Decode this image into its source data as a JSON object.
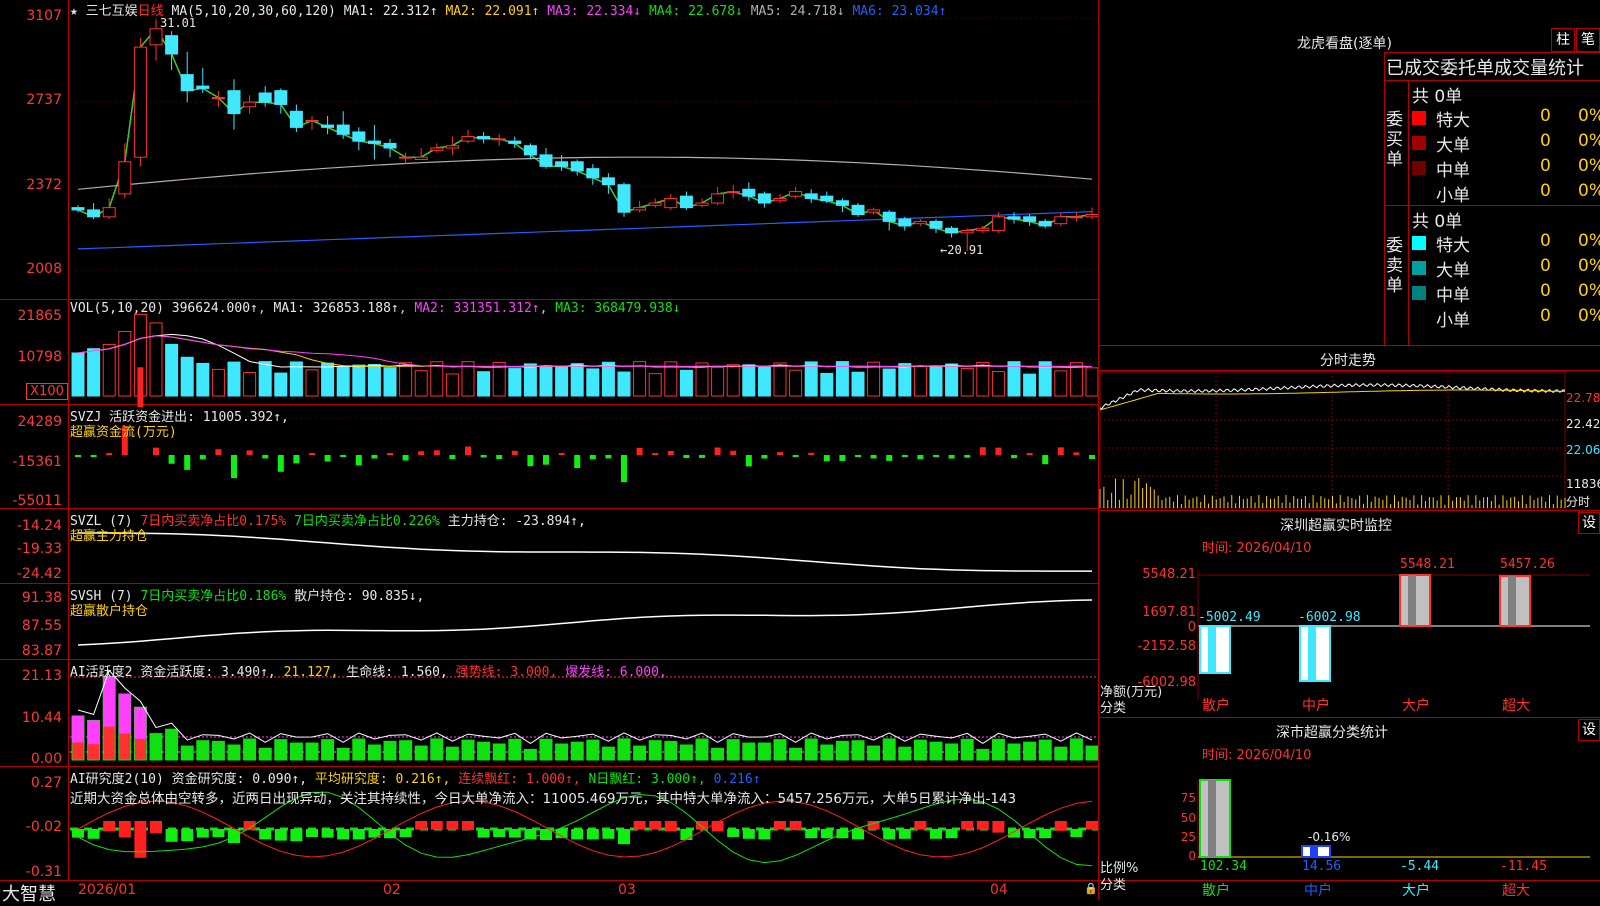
{
  "chart_title": {
    "stock": "三七互娱",
    "period": "日线",
    "ma_label": "MA(5,10,20,30,60,120)",
    "ma_values": [
      "MA1: 22.312↑",
      "MA2: 22.091↑",
      "MA3: 22.334↓",
      "MA4: 22.678↓",
      "MA5: 24.718↓",
      "MA6: 23.034↑"
    ],
    "peak_note": "31.01",
    "low_note": "←20.91"
  },
  "price_axis": [
    "3107",
    "2737",
    "2372",
    "2008"
  ],
  "vol": {
    "header": [
      "VOL(5,10,20)",
      "396624.000↑",
      "MA1: 326853.188↑",
      "MA2: 331351.312↑",
      "MA3: 368479.938↓"
    ],
    "axis": [
      "21865",
      "10798",
      "X100"
    ]
  },
  "svzj": {
    "header": "SVZJ  活跃资金进出: 11005.392↑,",
    "sub": "超赢资金流(万元)",
    "axis": [
      "24289",
      "-15361",
      "-55011"
    ]
  },
  "svzl": {
    "header_a": "SVZL (7)",
    "header_b": "7日内买卖净占比0.175%",
    "header_c": "7日内买卖净占比0.226%",
    "header_d": "主力持仓: -23.894↑,",
    "sub": "超赢主力持仓",
    "axis": [
      "-14.24",
      "-19.33",
      "-24.42"
    ]
  },
  "svsh": {
    "header_a": "SVSH (7)",
    "header_b": "7日内买卖净占比0.186%",
    "header_c": "散户持仓: 90.835↓,",
    "sub": "超赢散户持仓",
    "axis": [
      "91.38",
      "87.55",
      "83.87"
    ]
  },
  "ai_active": {
    "header_a": "AI活跃度2",
    "header_b": "资金活跃度: 3.490↑,",
    "header_c": "21.127,",
    "header_d": "生命线: 1.560,",
    "header_e": "强势线: 3.000,",
    "header_f": "爆发线: 6.000,",
    "axis": [
      "21.13",
      "10.44",
      "0.00"
    ]
  },
  "ai_research": {
    "header_a": "AI研究度2(10)",
    "header_b": "资金研究度: 0.090↑,",
    "header_c": "平均研究度: 0.216↑,",
    "header_d": "连续飘红: 1.000↑,",
    "header_e": "N日飘红: 3.000↑,",
    "header_f": "0.216↑",
    "comment": "近期大资金总体由空转多，近两日出现异动，关注其持续性，今日大单净流入：11005.469万元，其中特大单净流入：5457.256万元，大单5日累计净出-143",
    "axis": [
      "0.27",
      "-0.02",
      "-0.31"
    ]
  },
  "time_axis": [
    "2026/01",
    "02",
    "03",
    "04"
  ],
  "brand": "大智慧",
  "right_panel": {
    "longhu_title": "龙虎看盘(逐单)",
    "btn_bar": "柱",
    "btn_pen": "笔",
    "section_title": "已成交委托单成交量统计",
    "buy_side": "委买单",
    "sell_side": "委卖单",
    "buy_total": "共 0单",
    "sell_total": "共 0单",
    "buy_rows": [
      {
        "label": "特大",
        "count": "0",
        "pct": "0%",
        "color": "#ff0000"
      },
      {
        "label": "大单",
        "count": "0",
        "pct": "0%",
        "color": "#a00000"
      },
      {
        "label": "中单",
        "count": "0",
        "pct": "0%",
        "color": "#700000"
      },
      {
        "label": "小单",
        "count": "0",
        "pct": "0%",
        "color": "#000000"
      }
    ],
    "sell_rows": [
      {
        "label": "特大",
        "count": "0",
        "pct": "0%",
        "color": "#00ffff"
      },
      {
        "label": "大单",
        "count": "0",
        "pct": "0%",
        "color": "#00a0a0"
      },
      {
        "label": "中单",
        "count": "0",
        "pct": "0%",
        "color": "#008080"
      },
      {
        "label": "小单",
        "count": "0",
        "pct": "0%",
        "color": "#000000"
      }
    ],
    "intraday_title": "分时走势",
    "intraday_axis": [
      "22.78",
      "22.42",
      "22.06",
      "11836",
      "分时"
    ],
    "sz_monitor_title": "深圳超赢实时监控",
    "sz_monitor_btn": "设",
    "sz_date": "时间: 2026/04/10",
    "sz_axis": [
      "5548.21",
      "1697.81",
      "0",
      "-2152.58",
      "-6002.98"
    ],
    "sz_ylabel": "净额(万元)",
    "sz_xlabel": "分类",
    "sz_categories": [
      "散户",
      "中户",
      "大户",
      "超大"
    ],
    "sz_values": [
      "-5002.49",
      "-6002.98",
      "5548.21",
      "5457.26"
    ],
    "cls_title": "深市超赢分类统计",
    "cls_btn": "设",
    "cls_date": "时间: 2026/04/10",
    "cls_axis": [
      "75",
      "50",
      "25",
      "0"
    ],
    "cls_ylabel": "比例%",
    "cls_xlabel": "分类",
    "cls_values": [
      "102.34",
      "14.56",
      "-5.44",
      "-11.45"
    ],
    "cls_note": "-0.16%",
    "cls_categories": [
      "散户",
      "中户",
      "大户",
      "超大"
    ]
  },
  "chart_data": {
    "type": "candlestick",
    "ylim": [
      20.08,
      31.07
    ],
    "candles": [
      [
        22.8,
        22.7,
        22.9,
        22.6
      ],
      [
        22.7,
        22.4,
        23.0,
        22.3
      ],
      [
        22.4,
        22.8,
        23.2,
        22.3
      ],
      [
        23.4,
        24.8,
        25.6,
        23.2
      ],
      [
        25.0,
        29.8,
        30.2,
        24.6
      ],
      [
        29.9,
        30.6,
        31.01,
        29.2
      ],
      [
        30.3,
        29.5,
        30.5,
        28.8
      ],
      [
        28.6,
        27.9,
        29.6,
        27.4
      ],
      [
        28.1,
        28.0,
        28.9,
        27.8
      ],
      [
        27.6,
        27.6,
        27.9,
        27.2
      ],
      [
        27.9,
        26.9,
        28.4,
        26.2
      ],
      [
        27.2,
        27.4,
        27.7,
        26.9
      ],
      [
        27.8,
        27.4,
        28.1,
        27.2
      ],
      [
        27.9,
        27.3,
        28.0,
        26.9
      ],
      [
        27.0,
        26.3,
        27.3,
        26.1
      ],
      [
        26.6,
        26.6,
        26.8,
        26.2
      ],
      [
        26.4,
        26.3,
        26.8,
        26.0
      ],
      [
        26.4,
        26.0,
        27.0,
        25.8
      ],
      [
        26.1,
        25.7,
        26.3,
        25.3
      ],
      [
        25.7,
        25.6,
        26.4,
        24.9
      ],
      [
        25.6,
        25.4,
        25.8,
        25.0
      ],
      [
        25.0,
        25.0,
        25.2,
        24.7
      ],
      [
        24.9,
        25.0,
        25.4,
        24.9
      ],
      [
        25.3,
        25.4,
        25.6,
        25.2
      ],
      [
        25.4,
        25.5,
        25.9,
        25.1
      ],
      [
        25.7,
        25.9,
        26.2,
        25.6
      ],
      [
        25.9,
        25.8,
        26.1,
        25.6
      ],
      [
        25.8,
        25.8,
        26.0,
        25.5
      ],
      [
        25.7,
        25.6,
        25.9,
        25.4
      ],
      [
        25.5,
        25.1,
        25.6,
        24.9
      ],
      [
        25.1,
        24.6,
        25.4,
        24.5
      ],
      [
        24.8,
        24.6,
        25.1,
        24.4
      ],
      [
        24.8,
        24.4,
        24.9,
        24.2
      ],
      [
        24.5,
        24.1,
        24.7,
        23.8
      ],
      [
        24.1,
        23.8,
        24.3,
        23.4
      ],
      [
        23.8,
        22.6,
        23.9,
        22.4
      ],
      [
        22.7,
        22.8,
        23.1,
        22.6
      ],
      [
        22.9,
        23.0,
        23.2,
        22.8
      ],
      [
        22.8,
        23.2,
        23.4,
        22.7
      ],
      [
        23.3,
        22.8,
        23.5,
        22.7
      ],
      [
        22.9,
        23.0,
        23.2,
        22.8
      ],
      [
        23.0,
        23.4,
        23.7,
        22.9
      ],
      [
        23.5,
        23.5,
        23.8,
        23.2
      ],
      [
        23.6,
        23.3,
        23.9,
        23.1
      ],
      [
        23.4,
        23.0,
        23.5,
        22.8
      ],
      [
        23.1,
        23.2,
        23.4,
        23.0
      ],
      [
        23.3,
        23.5,
        23.7,
        23.2
      ],
      [
        23.4,
        23.2,
        23.6,
        23.0
      ],
      [
        23.3,
        23.1,
        23.5,
        23.0
      ],
      [
        23.1,
        22.9,
        23.2,
        22.6
      ],
      [
        22.9,
        22.5,
        23.0,
        22.4
      ],
      [
        22.6,
        22.7,
        22.8,
        22.5
      ],
      [
        22.6,
        22.2,
        22.7,
        21.8
      ],
      [
        22.3,
        22.0,
        22.4,
        21.8
      ],
      [
        22.1,
        22.2,
        22.3,
        22.0
      ],
      [
        22.2,
        21.9,
        22.3,
        21.7
      ],
      [
        21.9,
        21.7,
        22.0,
        21.5
      ],
      [
        21.7,
        21.8,
        21.9,
        20.91
      ],
      [
        21.8,
        21.9,
        22.0,
        21.7
      ],
      [
        21.8,
        22.4,
        22.6,
        21.7
      ],
      [
        22.4,
        22.3,
        22.6,
        22.1
      ],
      [
        22.4,
        22.2,
        22.5,
        22.0
      ],
      [
        22.2,
        22.0,
        22.3,
        21.9
      ],
      [
        22.1,
        22.4,
        22.6,
        22.0
      ],
      [
        22.4,
        22.4,
        22.6,
        22.2
      ],
      [
        22.4,
        22.5,
        22.8,
        22.3
      ]
    ]
  }
}
